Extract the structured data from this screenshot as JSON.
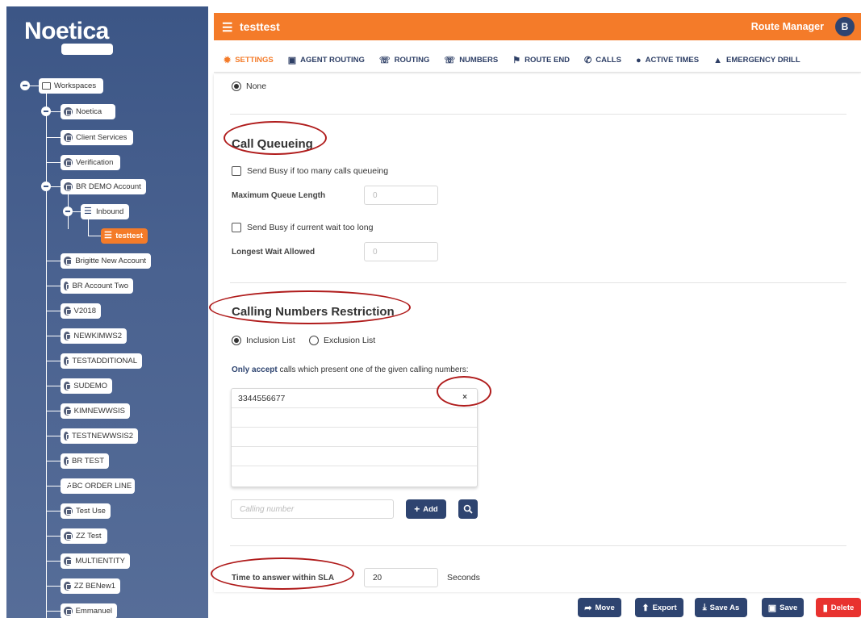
{
  "brand": {
    "logo_text": "Noetica",
    "logo_accent": "#f26b1d"
  },
  "colors": {
    "sidebar": "#3c5686",
    "header": "#f47b29",
    "navy": "#2e4470",
    "danger": "#e8322f",
    "annotation": "#b01c1c"
  },
  "tree": {
    "root": "Workspaces",
    "items": [
      "Noetica",
      "Client Services",
      "Verification",
      "BR DEMO Account",
      "Inbound",
      "testtest",
      "Brigitte New Account",
      "BR Account Two",
      "V2018",
      "NEWKIMWS2",
      "TESTADDITIONAL",
      "SUDEMO",
      "KIMNEWWSIS",
      "TESTNEWWSIS2",
      "BR TEST",
      "ABC ORDER LINE",
      "Test Use",
      "ZZ Test",
      "MULTIENTITY",
      "ZZ BENew1",
      "Emmanuel"
    ]
  },
  "header": {
    "title": "testtest",
    "app_name": "Route Manager",
    "avatar_initial": "B"
  },
  "tabs": [
    {
      "label": "SETTINGS",
      "icon": "gear-icon"
    },
    {
      "label": "AGENT ROUTING",
      "icon": "agent-icon"
    },
    {
      "label": "ROUTING",
      "icon": "phone-routing-icon"
    },
    {
      "label": "NUMBERS",
      "icon": "phone-numbers-icon"
    },
    {
      "label": "ROUTE END",
      "icon": "flag-icon"
    },
    {
      "label": "CALLS",
      "icon": "phone-icon"
    },
    {
      "label": "ACTIVE TIMES",
      "icon": "clock-icon"
    },
    {
      "label": "EMERGENCY DRILL",
      "icon": "warning-icon"
    }
  ],
  "settings": {
    "none_option": "None",
    "queue": {
      "title": "Call Queueing",
      "busy_queue_label": "Send Busy if too many calls queueing",
      "max_queue_label": "Maximum Queue Length",
      "max_queue_placeholder": "0",
      "busy_wait_label": "Send Busy if current wait too long",
      "longest_wait_label": "Longest Wait Allowed",
      "longest_wait_placeholder": "0"
    },
    "restriction": {
      "title": "Calling Numbers Restriction",
      "inclusion_label": "Inclusion List",
      "exclusion_label": "Exclusion List",
      "description_bold": "Only accept",
      "description_rest": " calls which present one of the given calling numbers:",
      "numbers": [
        "3344556677"
      ],
      "remove_glyph": "×",
      "input_placeholder": "Calling number",
      "add_label": "Add"
    },
    "sla": {
      "label": "Time to answer within SLA",
      "value": "20",
      "unit": "Seconds"
    }
  },
  "footer": {
    "move": "Move",
    "export": "Export",
    "save_as": "Save As",
    "save": "Save",
    "delete": "Delete"
  }
}
